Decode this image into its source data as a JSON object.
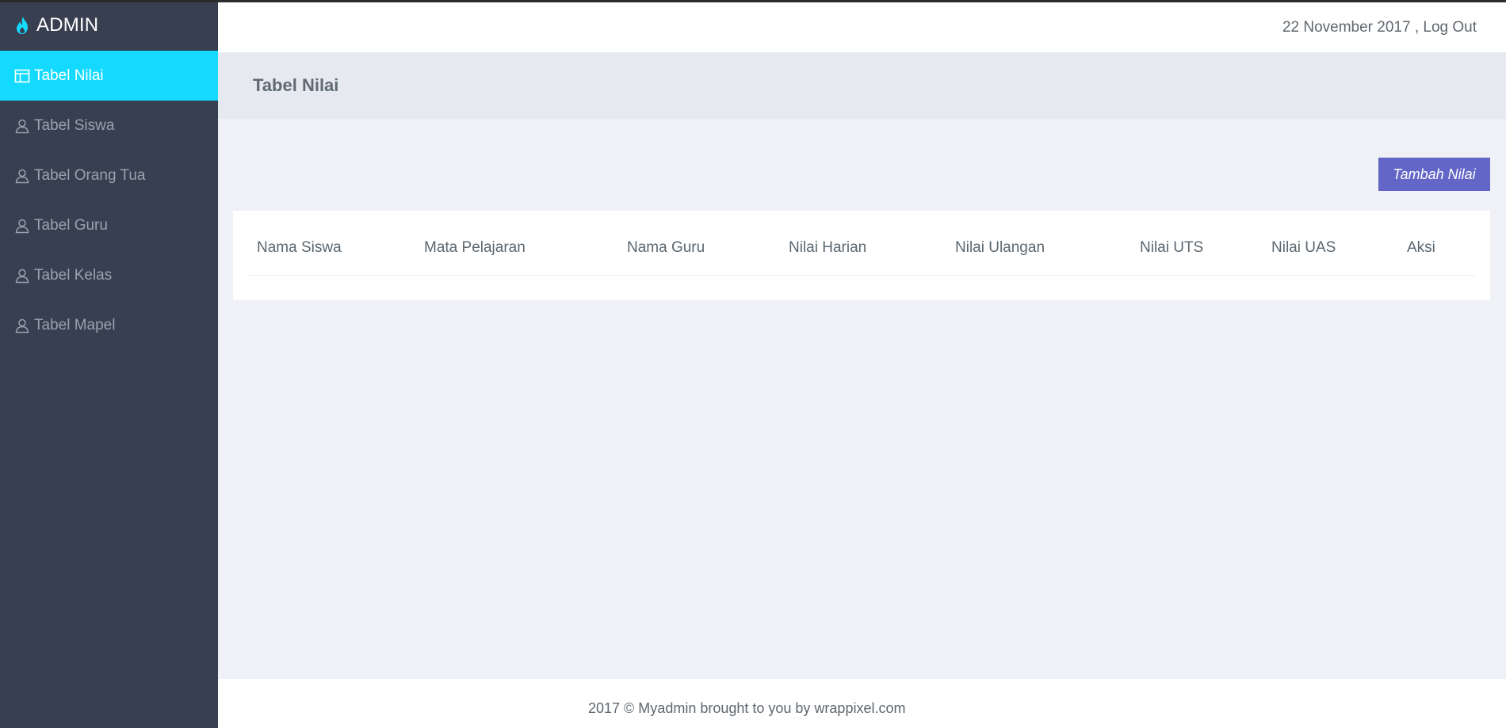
{
  "brand": {
    "name": "ADMIN",
    "icon": "flame-icon"
  },
  "sidebar": {
    "items": [
      {
        "label": "Tabel Nilai",
        "icon": "table-icon",
        "active": true
      },
      {
        "label": "Tabel Siswa",
        "icon": "user-icon",
        "active": false
      },
      {
        "label": "Tabel Orang Tua",
        "icon": "user-icon",
        "active": false
      },
      {
        "label": "Tabel Guru",
        "icon": "user-icon",
        "active": false
      },
      {
        "label": "Tabel Kelas",
        "icon": "user-icon",
        "active": false
      },
      {
        "label": "Tabel Mapel",
        "icon": "user-icon",
        "active": false
      }
    ]
  },
  "topbar": {
    "date": "22 November 2017",
    "separator": " , ",
    "logout": "Log Out"
  },
  "page": {
    "title": "Tabel Nilai",
    "add_button": "Tambah Nilai"
  },
  "table": {
    "columns": [
      "Nama Siswa",
      "Mata Pelajaran",
      "Nama Guru",
      "Nilai Harian",
      "Nilai Ulangan",
      "Nilai UTS",
      "Nilai UAS",
      "Aksi"
    ],
    "rows": []
  },
  "footer": {
    "text": "2017 © Myadmin brought to you by wrappixel.com"
  },
  "colors": {
    "sidebar_bg": "#383f51",
    "active_bg": "#13dafe",
    "button_bg": "#6366c7",
    "content_bg": "#eff1f6"
  }
}
